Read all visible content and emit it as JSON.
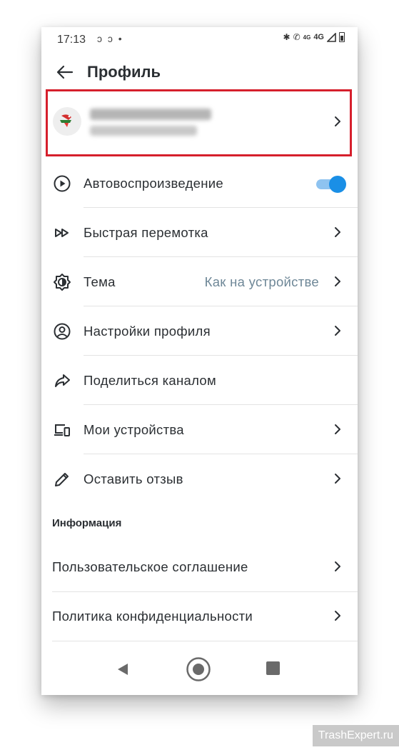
{
  "status_bar": {
    "time": "17:13",
    "notifications": "ↄ ↄ •",
    "network_small": "4G",
    "network": "4G"
  },
  "app_bar": {
    "title": "Профиль"
  },
  "settings": [
    {
      "id": "autoplay",
      "label": "Автовоспроизведение",
      "icon": "play-circle-icon",
      "toggle_on": true
    },
    {
      "id": "fast-forward",
      "label": "Быстрая перемотка",
      "icon": "fast-forward-icon"
    },
    {
      "id": "theme",
      "label": "Тема",
      "value": "Как на устройстве",
      "icon": "theme-icon"
    },
    {
      "id": "profile-settings",
      "label": "Настройки профиля",
      "icon": "account-circle-icon"
    },
    {
      "id": "share-channel",
      "label": "Поделиться каналом",
      "icon": "share-icon"
    },
    {
      "id": "my-devices",
      "label": "Мои устройства",
      "icon": "devices-icon"
    },
    {
      "id": "feedback",
      "label": "Оставить отзыв",
      "icon": "pencil-icon"
    }
  ],
  "info_section": {
    "title": "Информация",
    "items": [
      {
        "label": "Пользовательское соглашение"
      },
      {
        "label": "Политика конфиденциальности"
      }
    ]
  },
  "watermark": "TrashExpert.ru",
  "colors": {
    "accent": "#1a8fe6",
    "highlight": "#d61f2c",
    "text": "#2b2f33",
    "secondary_text": "#6e8797"
  }
}
